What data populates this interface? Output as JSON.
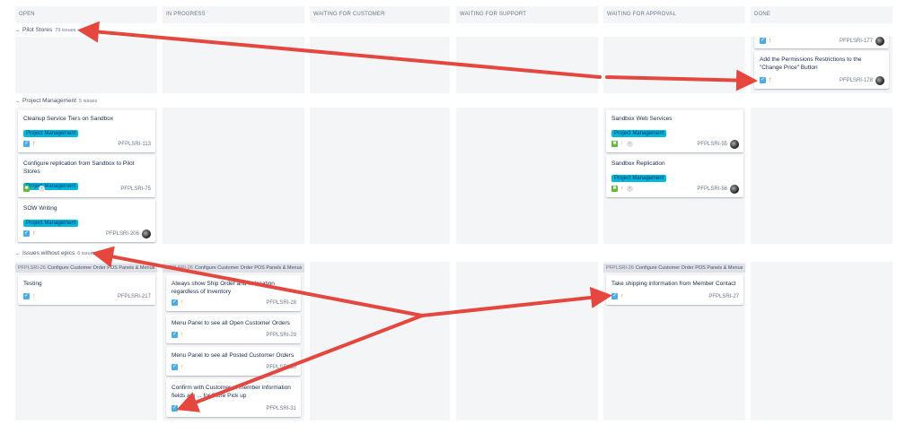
{
  "columns": [
    "OPEN",
    "IN PROGRESS",
    "WAITING FOR CUSTOMER",
    "WAITING FOR SUPPORT",
    "WAITING FOR APPROVAL",
    "DONE"
  ],
  "swimlanes": {
    "pilot": {
      "name": "Pilot Stores",
      "count": "79 issues"
    },
    "pm": {
      "name": "Project Management",
      "count": "5 issues"
    },
    "noepic": {
      "name": "Issues without epics",
      "count": "6 issues"
    }
  },
  "chevron": "⌄",
  "cards": {
    "c177": {
      "key": "PFPLSRI-177"
    },
    "c178": {
      "title": "Add the Permissions Restrictions to the \"Change Price\" Button",
      "key": "PFPLSRI-178"
    },
    "c113": {
      "title": "Cleanup Service Tiers on Sandbox",
      "epic": "Project Management",
      "key": "PFPLSRI-113"
    },
    "c75": {
      "title": "Configure replication from Sandbox to Pilot Stores",
      "epic": "Project Management",
      "key": "PFPLSRI-75",
      "est": "-"
    },
    "c206": {
      "title": "SOW Writing",
      "epic": "Project Management",
      "key": "PFPLSRI-206"
    },
    "c55": {
      "title": "Sandbox Web Services",
      "epic": "Project Management",
      "key": "PFPLSRI-55",
      "est": "-"
    },
    "c56": {
      "title": "Sandbox Replication",
      "epic": "Project Management",
      "key": "PFPLSRI-56",
      "est": "-"
    },
    "c217": {
      "title": "Testing",
      "key": "PFPLSRI-217"
    },
    "c28": {
      "title": "Always show Ship Order and ... location regardless of Inventory",
      "key": "PFPLSRI-28"
    },
    "c29": {
      "title": "Menu Panel to see all Open Customer Orders",
      "key": "PFPLSRI-29"
    },
    "c30": {
      "title": "Menu Panel to see all Posted Customer Orders",
      "key": "PFPLSRI-30"
    },
    "c31": {
      "title": "Confirm with Customer ... member information fields are ... for Store Pick up",
      "key": "PFPLSRI-31"
    },
    "c27": {
      "title": "Take shipping information from Member Contact",
      "key": "PFPLSRI-27"
    }
  },
  "parent": {
    "key": "PFPLSRI-26",
    "title": "Configure Customer Order POS Panels & Menus"
  },
  "icons": {
    "task": "task-icon",
    "story": "story-icon",
    "priority": "arrow-up-icon",
    "avatar": "avatar"
  },
  "colors": {
    "arrow": "#e5473f",
    "epic": "#00b8d9",
    "lane": "#f4f5f7"
  }
}
